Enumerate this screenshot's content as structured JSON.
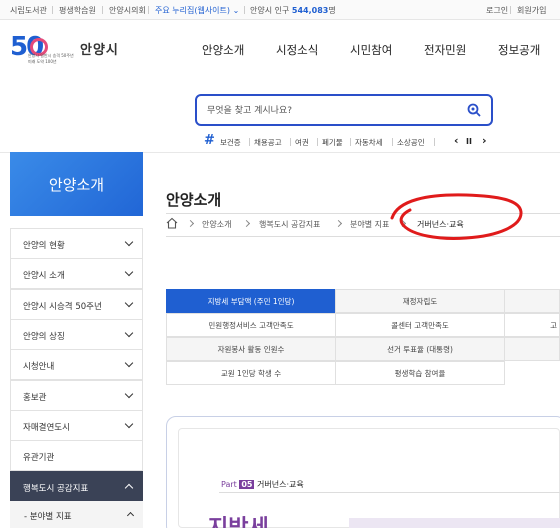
{
  "topbar": {
    "links": [
      "시립도서관",
      "평생학습원",
      "안양시의회"
    ],
    "popular_sites": "주요 누리집(웹사이트)",
    "population_label": "안양시 인구",
    "population_value": "544,083",
    "population_unit": "명",
    "login": "로그인",
    "signup": "회원가입"
  },
  "header": {
    "logo_number": "50",
    "logo_sub1": "안양시 일반시 승격 50주년",
    "logo_sub2": "미래 도약 100년",
    "city_name": "안양시",
    "nav": [
      "안양소개",
      "시정소식",
      "시민참여",
      "전자민원",
      "정보공개"
    ]
  },
  "search": {
    "placeholder": "무엇을 찾고 계시나요?"
  },
  "keywords": {
    "items": [
      "보건증",
      "채용공고",
      "여권",
      "폐기물",
      "자동차세",
      "소상공인"
    ],
    "prev": "‹",
    "pause": "II",
    "next": "›"
  },
  "sidebar": {
    "title": "안양소개",
    "items": [
      {
        "label": "안양의 현황"
      },
      {
        "label": "안양시 소개"
      },
      {
        "label": "안양시 시승격 50주년"
      },
      {
        "label": "안양의 상징"
      },
      {
        "label": "시청안내"
      },
      {
        "label": "홍보관"
      },
      {
        "label": "자매결연도시"
      },
      {
        "label": "유관기관"
      },
      {
        "label": "행복도시 공감지표"
      }
    ],
    "sub_item": "분야별 지표"
  },
  "main": {
    "title": "안양소개",
    "breadcrumbs": [
      "안양소개",
      "행복도시 공감지표",
      "분야별 지표",
      "거버넌스·교육"
    ]
  },
  "indicators": {
    "rows": [
      [
        "지방세 부담액 (주민 1인당)",
        "재정자립도"
      ],
      [
        "민원행정서비스 고객만족도",
        "콜센터 고객만족도",
        "고"
      ],
      [
        "자원봉사 활동 인원수",
        "선거 투표율 (대통령)"
      ],
      [
        "교원 1인당 학생 수",
        "평생학습 참여율"
      ]
    ]
  },
  "card": {
    "part_label": "Part",
    "part_number": "05",
    "part_title": "거버넌스·교육",
    "big_title": "지방세"
  },
  "colors": {
    "primary": "#1f5fd1",
    "sidebar_active": "#3a4256",
    "accent_purple": "#7a3f9d",
    "annotation_red": "#e01b1b"
  }
}
